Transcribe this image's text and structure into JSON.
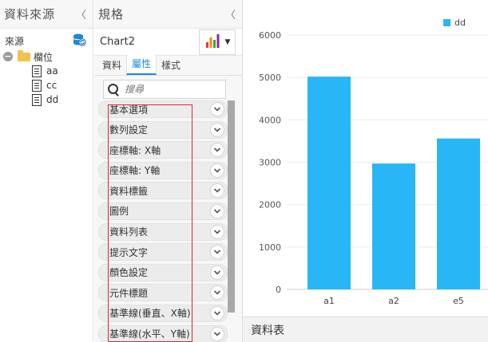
{
  "left_panel": {
    "title": "資料來源",
    "collapse_glyph": "〈",
    "source_label": "來源",
    "tree": {
      "folder_label": "欄位",
      "items": [
        "aa",
        "cc",
        "dd"
      ]
    }
  },
  "spec_panel": {
    "title": "規格",
    "collapse_glyph": "〈",
    "chart_name": "Chart2",
    "tabs": [
      {
        "label": "資料",
        "active": false
      },
      {
        "label": "屬性",
        "active": true
      },
      {
        "label": "樣式",
        "active": false
      }
    ],
    "search": {
      "placeholder": "搜尋"
    },
    "properties": [
      "基本選項",
      "數列設定",
      "座標軸: X軸",
      "座標軸: Y軸",
      "資料標籤",
      "圖例",
      "資料列表",
      "提示文字",
      "顏色設定",
      "元件標題",
      "基準線(垂直、X軸)",
      "基準線(水平、Y軸)"
    ]
  },
  "bottom_panel": {
    "title": "資料表"
  },
  "colors": {
    "bar": "#29b6f6",
    "highlight_box": "#d32f2f",
    "active_tab": "#1a8bd6"
  },
  "icons": {
    "data_source": "database-sync-icon",
    "chart_type": "bar-chart-icon",
    "search": "search-icon",
    "expand": "chevron-down-icon",
    "tree_toggle": "minus-circle-icon",
    "folder": "folder-icon",
    "field": "document-icon"
  },
  "chart_data": {
    "type": "bar",
    "categories": [
      "a1",
      "a2",
      "e5"
    ],
    "series": [
      {
        "name": "dd",
        "values": [
          5020,
          2970,
          3560
        ]
      }
    ],
    "yticks": [
      0,
      1000,
      2000,
      3000,
      4000,
      5000,
      6000
    ],
    "ylim": [
      0,
      6000
    ],
    "legend": "top-right",
    "grid": true
  }
}
